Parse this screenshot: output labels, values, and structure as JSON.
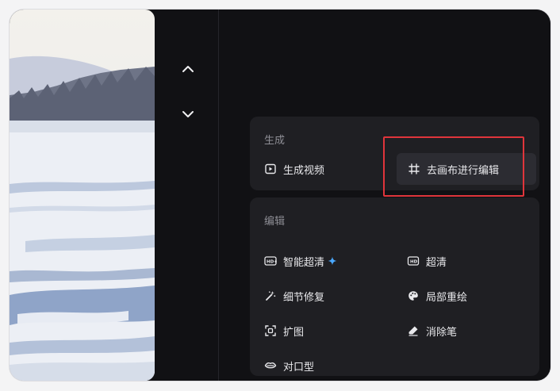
{
  "navigation": {
    "up_icon": "chevron-up-icon",
    "down_icon": "chevron-down-icon"
  },
  "generate_section": {
    "title": "生成",
    "items": [
      {
        "label": "生成视频",
        "icon": "play-video-icon"
      },
      {
        "label": "去画布进行编辑",
        "icon": "canvas-crop-icon"
      }
    ]
  },
  "edit_section": {
    "title": "编辑",
    "items": [
      {
        "label": "智能超清",
        "icon": "hd-plus-icon",
        "badge_icon": "sparkle-icon"
      },
      {
        "label": "超清",
        "icon": "hd-icon"
      },
      {
        "label": "细节修复",
        "icon": "magic-wand-icon"
      },
      {
        "label": "局部重绘",
        "icon": "palette-icon"
      },
      {
        "label": "扩图",
        "icon": "expand-icon"
      },
      {
        "label": "消除笔",
        "icon": "eraser-icon"
      },
      {
        "label": "对口型",
        "icon": "lips-icon"
      }
    ]
  },
  "colors": {
    "background": "#111114",
    "card": "#1f1f23",
    "highlight": "#2c2c32",
    "text": "#e9e9ec",
    "muted": "#8e8e95",
    "accent": "#4aa8ff",
    "annotation": "#e0353b"
  }
}
